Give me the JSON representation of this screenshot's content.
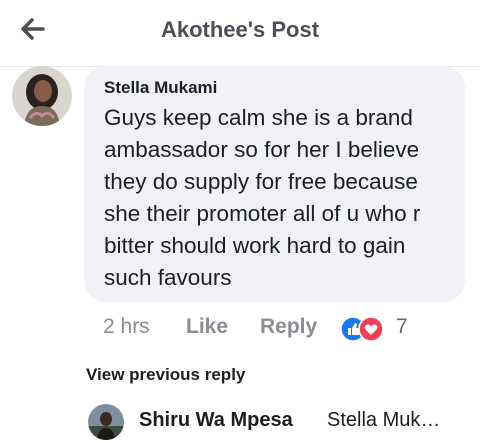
{
  "header": {
    "title": "Akothee's Post",
    "back_icon": "arrow-left-icon"
  },
  "comment": {
    "author": "Stella Mukami",
    "text": "Guys keep calm she is a brand ambassador so for her I believe they do supply for free because she their promoter all of u who r bitter should work hard to gain such favours",
    "time": "2 hrs",
    "like_label": "Like",
    "reply_label": "Reply",
    "reaction_count": "7",
    "reaction_icons": [
      "thumbs-up-icon",
      "heart-icon"
    ]
  },
  "replies": {
    "view_previous_label": "View previous reply",
    "latest": {
      "author": "Shiru Wa Mpesa",
      "preview": "Stella Mukami"
    }
  },
  "colors": {
    "like_blue": "#1877f2",
    "love_red": "#f33e58",
    "bubble_bg": "#f0f2f5"
  }
}
